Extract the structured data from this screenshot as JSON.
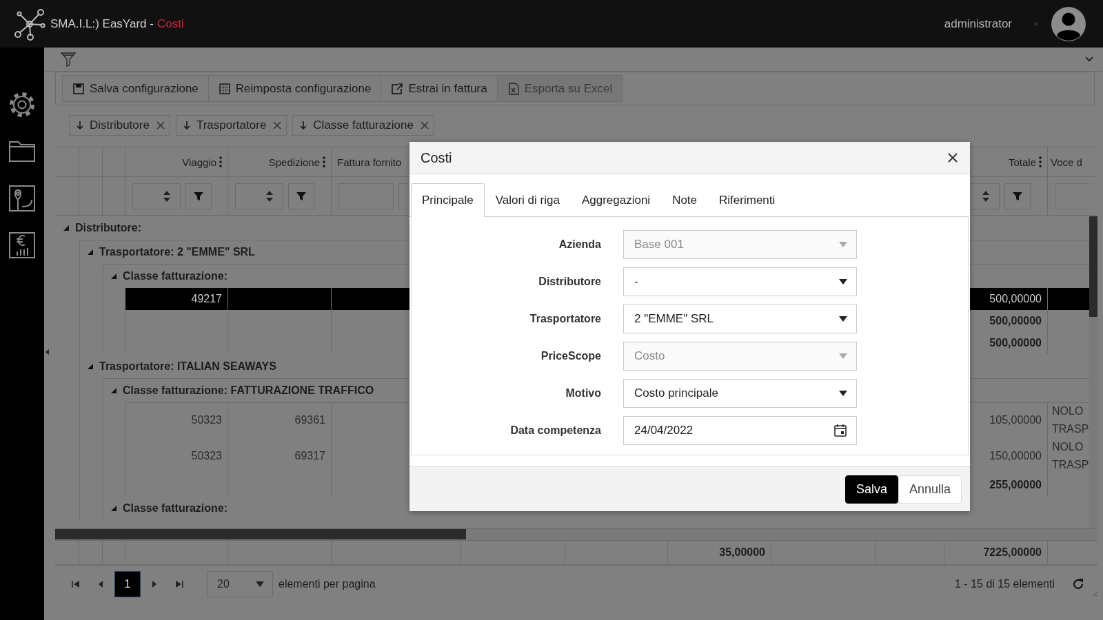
{
  "header": {
    "app_title": "SMA.I.L:) EasYard -",
    "page_title": "Costi",
    "user": "administrator"
  },
  "toolbar": {
    "buttons": [
      "Salva configurazione",
      "Reimposta configurazione",
      "Estrai in fattura",
      "Esporta su Excel"
    ]
  },
  "group_chips": [
    "Distributore",
    "Trasportatore",
    "Classe fatturazione"
  ],
  "grid": {
    "columns": [
      {
        "label": "Viaggio",
        "menu": true,
        "kind": "number"
      },
      {
        "label": "Spedizione",
        "menu": true,
        "kind": "number"
      },
      {
        "label": "Fattura fornito",
        "menu": false,
        "kind": "text"
      },
      {
        "label": "Totale",
        "menu": true,
        "kind": "number"
      },
      {
        "label": "Voce d",
        "menu": false,
        "kind": "dropdown"
      }
    ],
    "groups": [
      {
        "label": "Distributore:",
        "expanded": true,
        "children": [
          {
            "label": "Trasportatore: 2 \"EMME\" SRL",
            "expanded": true,
            "children": [
              {
                "label": "Classe fatturazione:",
                "expanded": true,
                "rows": [
                  {
                    "viaggio": "49217",
                    "totale": "500,00000",
                    "selected": true
                  }
                ],
                "totals": [
                  "500,00000",
                  "500,00000"
                ]
              }
            ]
          },
          {
            "label": "Trasportatore: ITALIAN SEAWAYS",
            "expanded": true,
            "children": [
              {
                "label": "Classe fatturazione: FATTURAZIONE TRAFFICO",
                "expanded": true,
                "rows": [
                  {
                    "viaggio": "50323",
                    "spedizione": "69361",
                    "totale": "105,00000",
                    "voce": "NOLO TRASP",
                    "selected": false
                  },
                  {
                    "viaggio": "50323",
                    "spedizione": "69317",
                    "totale": "150,00000",
                    "voce": "NOLO TRASP",
                    "selected": false
                  }
                ],
                "totals": [
                  "255,00000"
                ]
              },
              {
                "label": "Classe fatturazione:",
                "expanded": true
              }
            ]
          }
        ]
      }
    ],
    "footer": {
      "column_9": "35,00000",
      "totale": "7225,00000"
    }
  },
  "pager": {
    "pages": [
      {
        "label": "1",
        "selected": true
      }
    ],
    "page_size": "20",
    "page_size_label": "elementi per pagina",
    "summary": "1 - 15 di 15 elementi"
  },
  "dialog": {
    "title": "Costi",
    "tabs": [
      {
        "label": "Principale",
        "selected": true
      },
      {
        "label": "Valori di riga",
        "selected": false
      },
      {
        "label": "Aggregazioni",
        "selected": false
      },
      {
        "label": "Note",
        "selected": false
      },
      {
        "label": "Riferimenti",
        "selected": false
      }
    ],
    "fields": [
      {
        "label": "Azienda",
        "value": "Base 001",
        "kind": "dropdown",
        "disabled": true
      },
      {
        "label": "Distributore",
        "value": "-",
        "kind": "dropdown",
        "disabled": false
      },
      {
        "label": "Trasportatore",
        "value": "2 \"EMME\" SRL",
        "kind": "dropdown",
        "disabled": false
      },
      {
        "label": "PriceScope",
        "value": "Costo",
        "kind": "dropdown",
        "disabled": true
      },
      {
        "label": "Motivo",
        "value": "Costo principale",
        "kind": "dropdown",
        "disabled": false
      },
      {
        "label": "Data competenza",
        "value": "24/04/2022",
        "kind": "date",
        "disabled": false
      }
    ],
    "buttons": [
      {
        "label": "Salva",
        "primary": true
      },
      {
        "label": "Annulla",
        "primary": false
      }
    ]
  }
}
